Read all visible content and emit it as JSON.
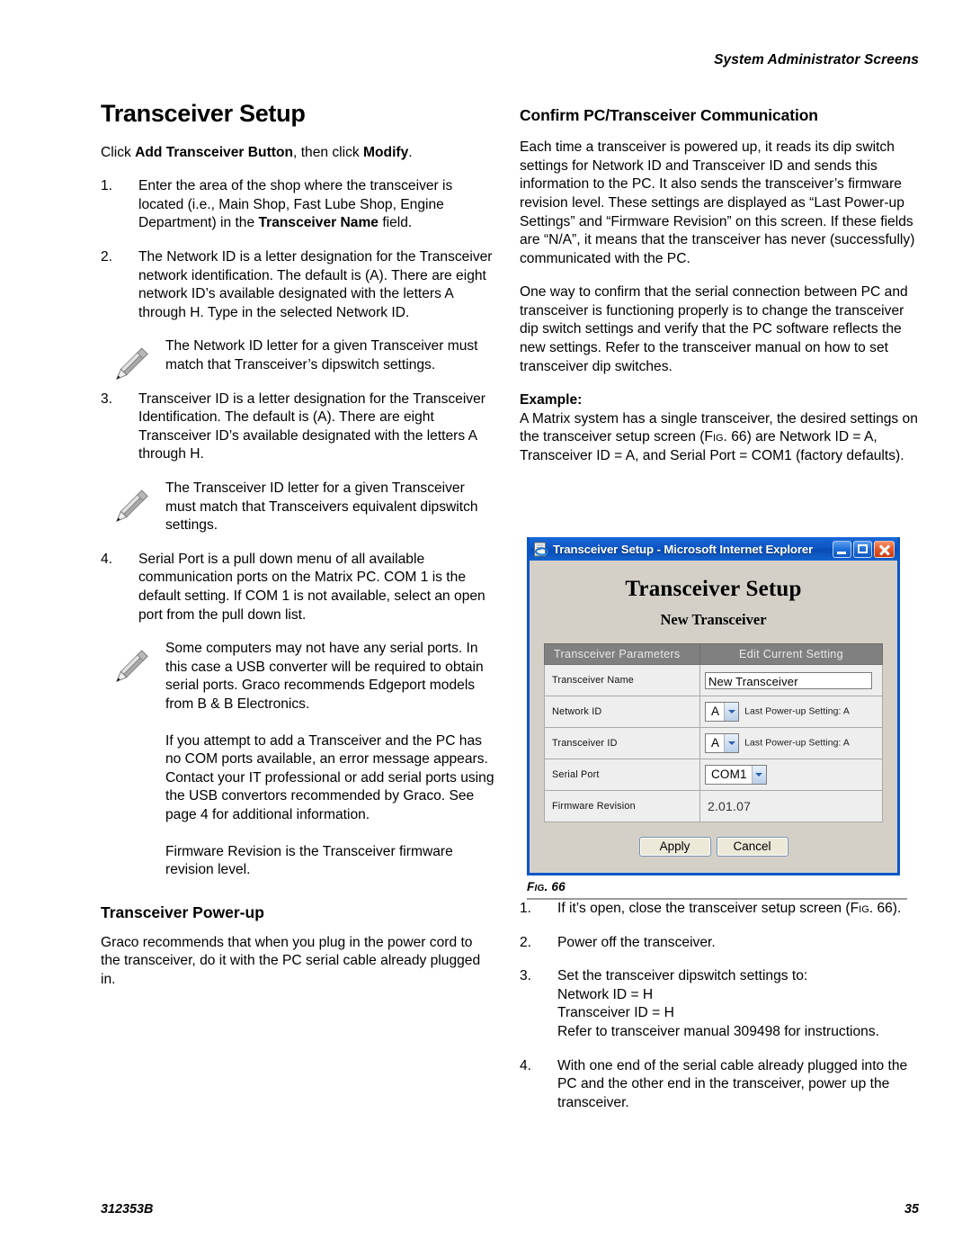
{
  "running_head": "System Administrator Screens",
  "left_column": {
    "title": "Transceiver Setup",
    "intro": {
      "pre": "Click ",
      "bold1": "Add Transceiver Button",
      "mid": ", then click ",
      "bold2": "Modify",
      "post": "."
    },
    "steps": [
      {
        "num": "1.",
        "pre": "Enter the area of the shop where the transceiver is located (i.e., Main Shop, Fast Lube Shop, Engine Department) in the ",
        "bold": "Transceiver Name",
        "post": " field."
      },
      {
        "num": "2.",
        "pre": "The Network ID is a letter designation for the Transceiver network identification. The default is (A). There are eight network ID’s available designated with the letters A through H. Type in the selected Network ID.",
        "bold": "",
        "post": ""
      },
      {
        "num": "3.",
        "pre": "Transceiver ID is a letter designation for the Transceiver Identification. The default is (A). There are eight Transceiver ID’s available designated with the letters A through H.",
        "bold": "",
        "post": ""
      },
      {
        "num": "4.",
        "pre": "Serial Port is a pull down menu of all available communication ports on the Matrix PC. COM 1 is the default setting. If COM 1 is not available, select an open port from the pull down list.",
        "bold": "",
        "post": ""
      }
    ],
    "note1": "The Network ID letter for a given Transceiver must match that Transceiver’s dipswitch settings.",
    "note2": "The Transceiver ID letter for a given Transceiver must match that Transceivers equivalent dipswitch settings.",
    "note3_p1": "Some computers may not have any serial ports. In this case a USB converter will be required to obtain serial ports. Graco recommends Edgeport models from B & B Electronics.",
    "note3_p2": "If you attempt to add a Transceiver and the PC has no COM ports available, an error message appears. Contact your IT professional or add serial ports using the USB convertors recommended by Graco. See page 4 for additional information.",
    "note3_p3": "Firmware Revision is the Transceiver firmware revision level.",
    "powerup_title": "Transceiver Power-up",
    "powerup_body": "Graco recommends that when you plug in the power cord to the transceiver, do it with the PC serial cable already plugged in."
  },
  "right_column": {
    "title": "Confirm PC/Transceiver Communication",
    "para1": "Each time a transceiver is powered up, it reads its dip switch settings for Network ID and Transceiver ID and sends this information to the PC. It also sends the transceiver’s firmware revision level. These settings are displayed as “Last Power-up Settings” and “Firmware Revision” on this screen. If these fields are “N/A”, it means that the transceiver has never (successfully) communicated with the PC.",
    "para2": "One way to confirm that the serial connection between PC and transceiver is functioning properly is to change the transceiver dip switch settings and verify that the PC software reflects the new settings. Refer to the transceiver manual on how to set transceiver dip switches.",
    "example_label": "Example:",
    "example_pre": "A Matrix system has a single transceiver, the desired settings on the transceiver setup screen (",
    "example_fig": "Fig. 66",
    "example_post": ") are Network ID = A, Transceiver ID = A, and Serial Port = COM1 (factory defaults)."
  },
  "figure": {
    "caption_prefix": "Fig.",
    "caption_number": "66",
    "caption": "Fig. 66",
    "window": {
      "titlebar_text": "Transceiver Setup - Microsoft Internet Explorer",
      "favicon": "ie-page-icon",
      "minimize_label": "minimize",
      "maximize_label": "maximize",
      "close_label": "close",
      "heading": "Transceiver Setup",
      "subheading": "New Transceiver",
      "table": {
        "headers": [
          "Transceiver Parameters",
          "Edit Current Setting"
        ],
        "rows": [
          {
            "label": "Transceiver Name",
            "type": "text",
            "value": "New Transceiver",
            "note": ""
          },
          {
            "label": "Network ID",
            "type": "select",
            "value": "A",
            "note": "Last Power-up Setting: A"
          },
          {
            "label": "Transceiver ID",
            "type": "select",
            "value": "A",
            "note": "Last Power-up Setting: A"
          },
          {
            "label": "Serial Port",
            "type": "select",
            "value": "COM1",
            "note": ""
          },
          {
            "label": "Firmware Revision",
            "type": "static",
            "value": "2.01.07",
            "note": ""
          }
        ]
      },
      "apply_label": "Apply",
      "cancel_label": "Cancel"
    }
  },
  "steps_below": [
    {
      "num": "1.",
      "pre": "If it’s open, close the transceiver setup screen (",
      "fig": "Fig.",
      "post": " 66)."
    },
    {
      "num": "2.",
      "pre": "Power off the transceiver.",
      "fig": "",
      "post": ""
    },
    {
      "num": "3.",
      "pre": "Set the transceiver dipswitch settings to:",
      "fig": "",
      "post": "",
      "sublines": [
        "Network ID = H",
        "Transceiver ID = H",
        "Refer to transceiver manual 309498 for instructions."
      ]
    },
    {
      "num": "4.",
      "pre": "With one end of the serial cable already plugged into the PC and the other end in the transceiver, power up the transceiver.",
      "fig": "",
      "post": ""
    }
  ],
  "footer": {
    "doc_number": "312353B",
    "page_number": "35"
  }
}
